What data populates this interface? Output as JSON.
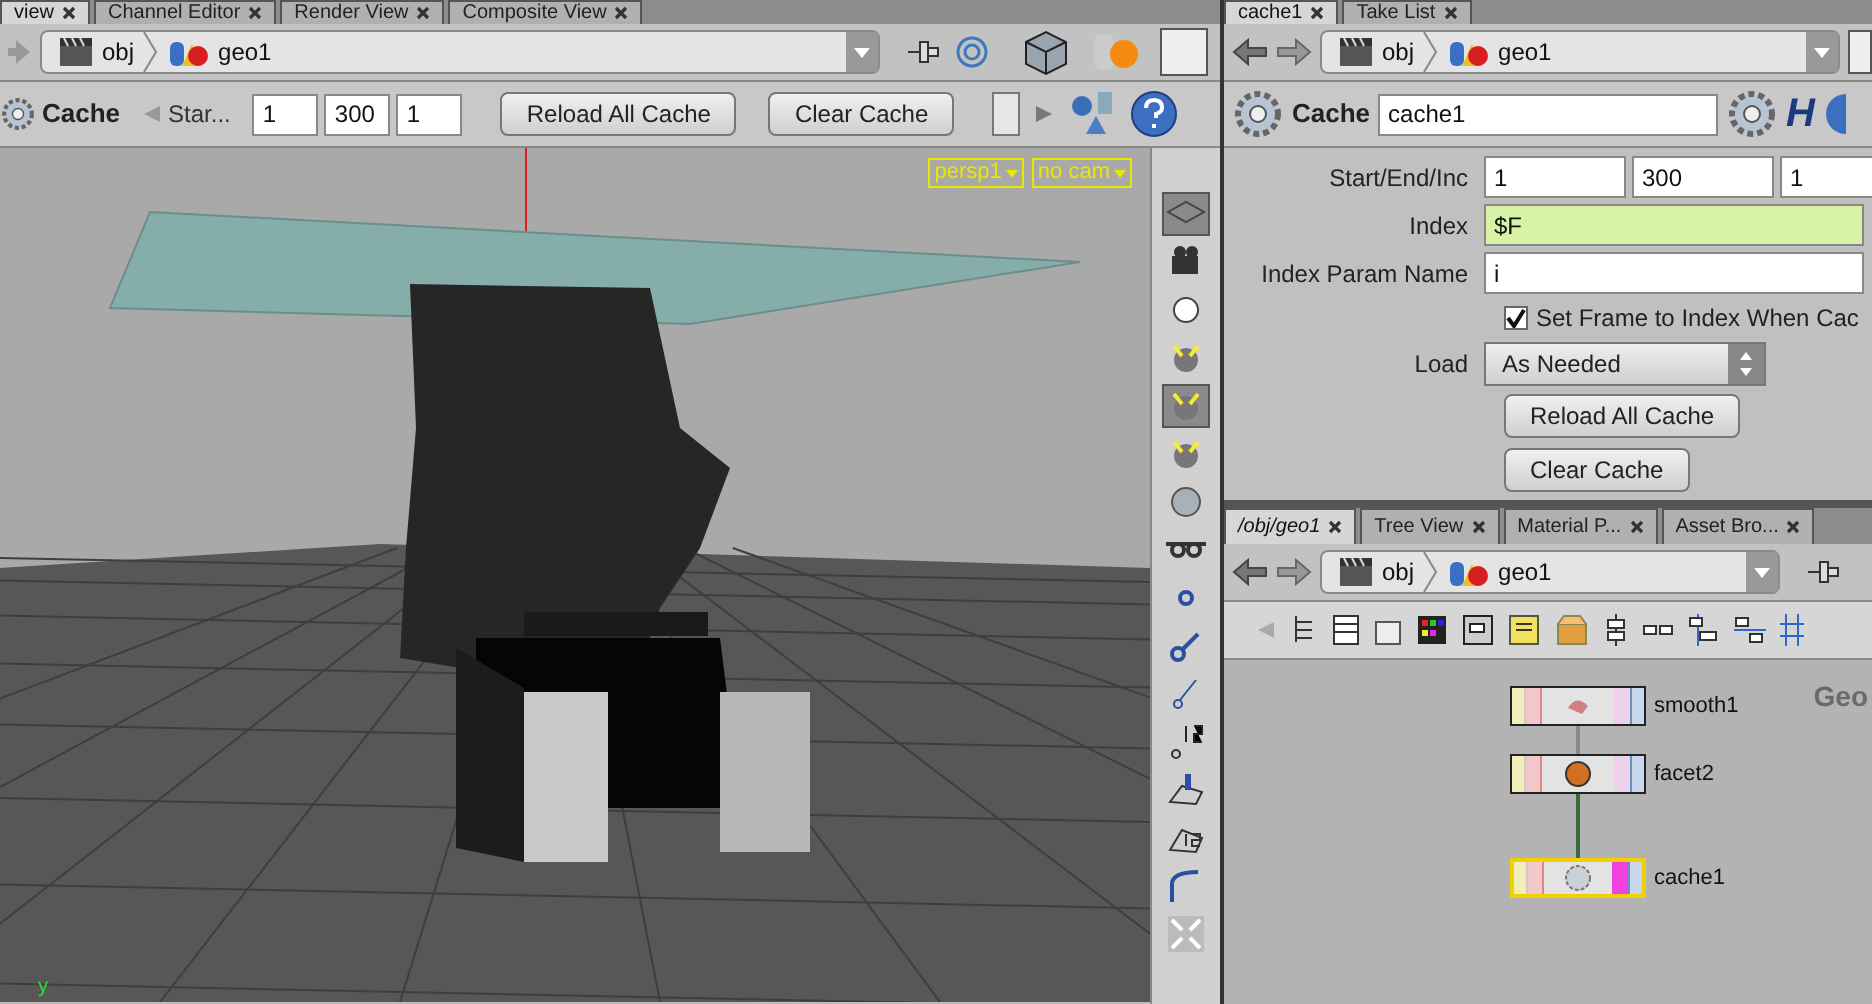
{
  "left_tabs": [
    {
      "label": "view",
      "selected": true
    },
    {
      "label": "Channel Editor",
      "selected": false
    },
    {
      "label": "Render View",
      "selected": false
    },
    {
      "label": "Composite View",
      "selected": false
    }
  ],
  "scene_path": [
    "obj",
    "geo1"
  ],
  "cache_toolbar": {
    "title": "Cache",
    "start_label": "Star...",
    "values": [
      "1",
      "300",
      "1"
    ],
    "buttons": [
      "Reload All Cache",
      "Clear Cache"
    ]
  },
  "viewport": {
    "camera": "persp1",
    "camera_menu": "no cam",
    "axis_label": "y"
  },
  "viewport_tools": [
    {
      "kind": "plane",
      "selected": true
    },
    {
      "kind": "camera",
      "selected": false
    },
    {
      "kind": "circle",
      "selected": false
    },
    {
      "kind": "light",
      "selected": false
    },
    {
      "kind": "light",
      "selected": true
    },
    {
      "kind": "light",
      "selected": false
    },
    {
      "kind": "sphere",
      "selected": false
    },
    {
      "kind": "glasses",
      "selected": false
    },
    {
      "kind": "point",
      "selected": false
    },
    {
      "kind": "vertex",
      "selected": false
    },
    {
      "kind": "edge",
      "selected": false
    },
    {
      "kind": "numbered-point",
      "selected": false
    },
    {
      "kind": "paint",
      "selected": false
    },
    {
      "kind": "numbered-face",
      "selected": false
    },
    {
      "kind": "curve",
      "selected": false
    },
    {
      "kind": "expand",
      "selected": false
    }
  ],
  "right_tabs": [
    {
      "label": "cache1",
      "selected": true
    },
    {
      "label": "Take List",
      "selected": false
    }
  ],
  "param_path": [
    "obj",
    "geo1"
  ],
  "parameters": {
    "node_type": "Cache",
    "node_name": "cache1",
    "logo": "H",
    "rows": [
      {
        "kind": "triple",
        "label": "Start/End/Inc",
        "values": [
          "1",
          "300",
          "1"
        ]
      },
      {
        "kind": "field",
        "label": "Index",
        "value": "$F",
        "expression": true
      },
      {
        "kind": "field",
        "label": "Index Param Name",
        "value": "i",
        "expression": false
      },
      {
        "kind": "checkbox",
        "label": "Set Frame to Index When Cac",
        "checked": true
      },
      {
        "kind": "menu",
        "label": "Load",
        "value": "As Needed"
      },
      {
        "kind": "button",
        "label": "Reload All Cache"
      },
      {
        "kind": "button",
        "label": "Clear Cache"
      }
    ]
  },
  "network_tabs": [
    {
      "label": "/obj/geo1",
      "selected": true
    },
    {
      "label": "Tree View",
      "selected": false
    },
    {
      "label": "Material P...",
      "selected": false
    },
    {
      "label": "Asset Bro...",
      "selected": false
    }
  ],
  "network_path": [
    "obj",
    "geo1"
  ],
  "network": {
    "context_label": "Geo",
    "nodes": [
      {
        "name": "smooth1",
        "kind": "smooth",
        "selected": false,
        "display": false
      },
      {
        "name": "facet2",
        "kind": "facet",
        "selected": false,
        "display": false
      },
      {
        "name": "cache1",
        "kind": "cache",
        "selected": true,
        "display": true
      }
    ]
  }
}
